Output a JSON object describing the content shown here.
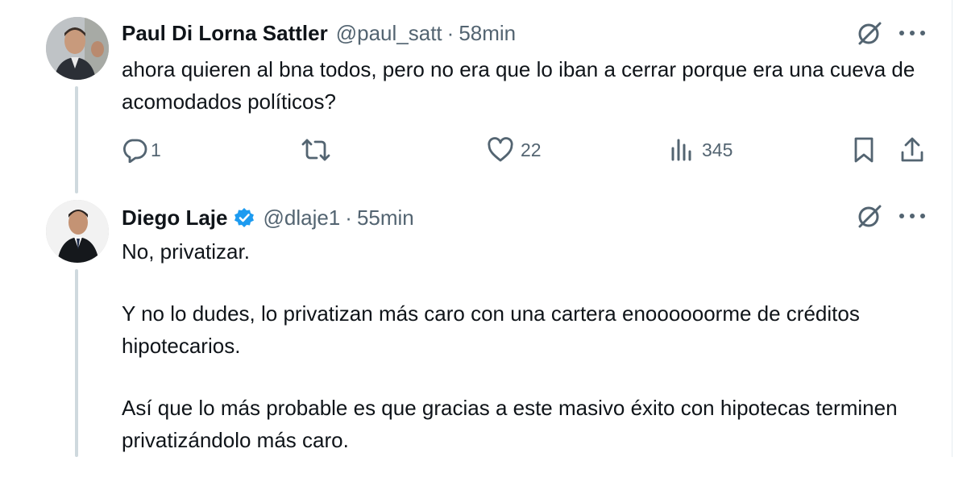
{
  "tweets": [
    {
      "name": "Paul Di Lorna Sattler",
      "handle": "@paul_satt",
      "separator": "·",
      "time": "58min",
      "verified": false,
      "text": [
        "ahora quieren al bna todos, pero no era que lo iban a cerrar porque era una cueva de acomodados políticos?"
      ],
      "avatar_icon": "avatar-photo",
      "stats": {
        "replies": "1",
        "retweets": "",
        "likes": "22",
        "views": "345"
      }
    },
    {
      "name": "Diego Laje",
      "handle": "@dlaje1",
      "separator": "·",
      "time": "55min",
      "verified": true,
      "verified_color": "#1d9bf0",
      "text": [
        "No, privatizar.",
        "Y no lo dudes, lo privatizan más caro con una cartera enoooooorme de créditos hipotecarios.",
        "Así que lo más probable es que gracias a este masivo éxito con hipotecas terminen privatizándolo más caro."
      ],
      "avatar_icon": "avatar-photo"
    }
  ],
  "colors": {
    "text": "#0f1419",
    "secondary": "#536471",
    "thread_line": "#cfd9de",
    "accent": "#1d9bf0"
  },
  "icons": [
    "grok-icon",
    "more-icon",
    "reply-icon",
    "retweet-icon",
    "like-icon",
    "views-icon",
    "bookmark-icon",
    "share-icon",
    "verified-badge-icon"
  ]
}
